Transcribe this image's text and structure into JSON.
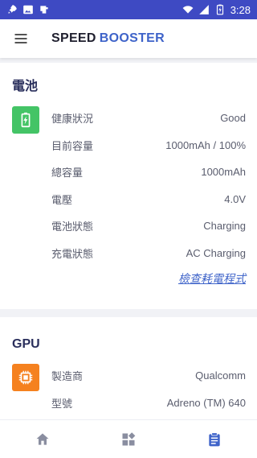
{
  "status_bar": {
    "time": "3:28",
    "icons": [
      "rocket-icon",
      "image-icon",
      "app-notification-icon",
      "wifi-icon",
      "signal-icon",
      "battery-icon"
    ]
  },
  "app_bar": {
    "menu_icon": "hamburger-menu-icon",
    "brand_part1": "SPEED",
    "brand_part2": "BOOSTER",
    "brand_accent_color": "#3e63c9"
  },
  "battery": {
    "title": "電池",
    "icon": "battery-charging-icon",
    "icon_color": "#44c466",
    "rows": [
      {
        "label": "健康狀況",
        "value": "Good"
      },
      {
        "label": "目前容量",
        "value": "1000mAh / 100%"
      },
      {
        "label": "總容量",
        "value": "1000mAh"
      },
      {
        "label": "電壓",
        "value": "4.0V"
      },
      {
        "label": "電池狀態",
        "value": "Charging"
      },
      {
        "label": "充電狀態",
        "value": "AC Charging"
      }
    ],
    "link_label": "檢查耗電程式"
  },
  "gpu": {
    "title": "GPU",
    "icon": "chip-icon",
    "icon_color": "#f5811f",
    "rows": [
      {
        "label": "製造商",
        "value": "Qualcomm"
      },
      {
        "label": "型號",
        "value": "Adreno (TM) 640"
      }
    ]
  },
  "bottom_nav": {
    "items": [
      {
        "icon": "home-icon",
        "active": false
      },
      {
        "icon": "dashboard-icon",
        "active": false
      },
      {
        "icon": "clipboard-icon",
        "active": true
      }
    ],
    "active_color": "#3e63c9",
    "inactive_color": "#8a8ea0"
  }
}
